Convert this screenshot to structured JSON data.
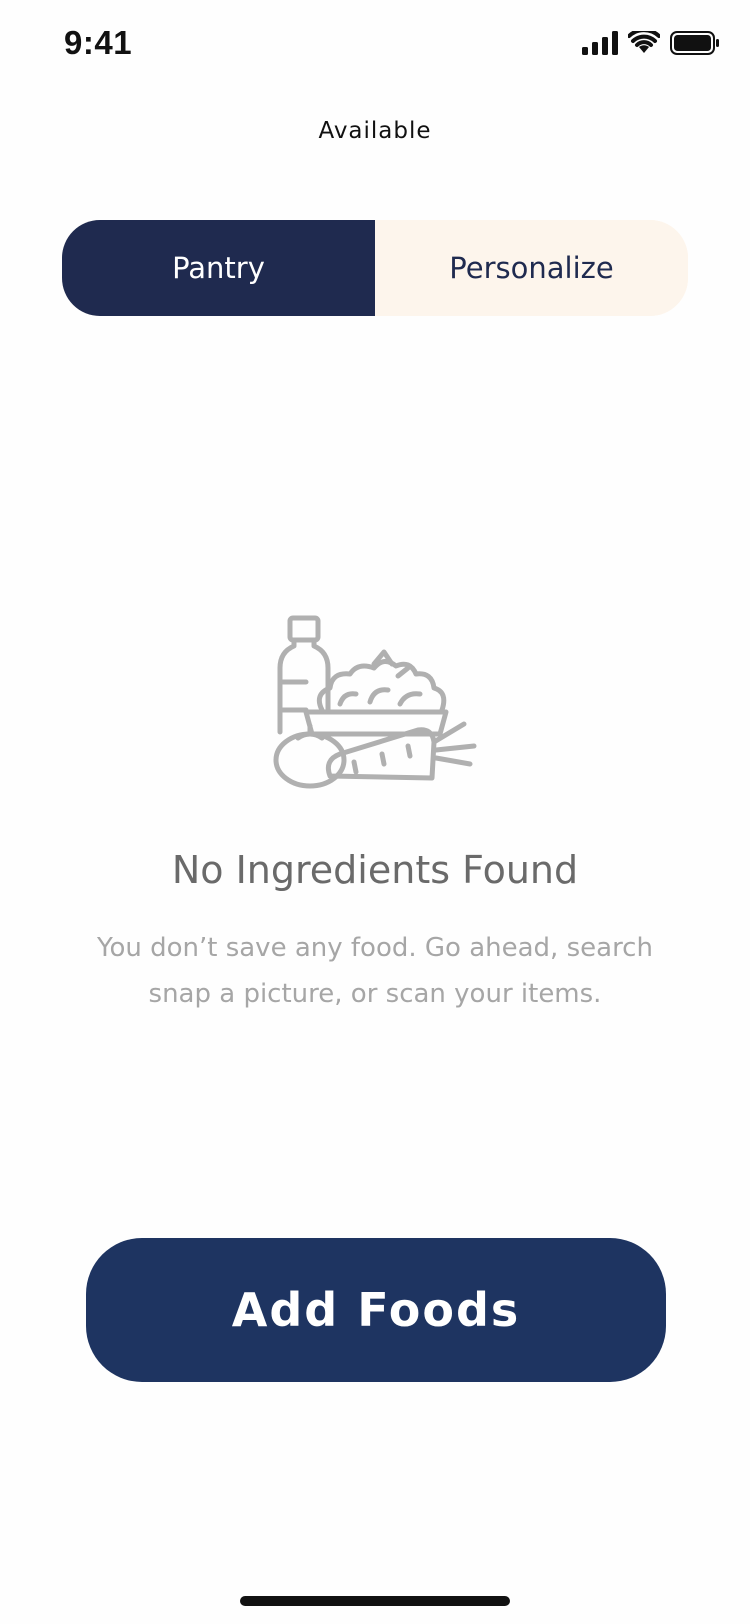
{
  "status_bar": {
    "time": "9:41",
    "icons": [
      "signal-icon",
      "wifi-icon",
      "battery-icon"
    ]
  },
  "header": {
    "title": "Available"
  },
  "segmented_control": {
    "tabs": [
      {
        "label": "Pantry",
        "active": true
      },
      {
        "label": "Personalize",
        "active": false
      }
    ]
  },
  "empty_state": {
    "icon": "groceries-icon",
    "title": "No Ingredients Found",
    "description_line1": "You don’t save any food. Go ahead, search",
    "description_line2": "snap a picture, or scan your items."
  },
  "actions": {
    "primary_label": "Add Foods"
  },
  "colors": {
    "primary": "#1f2a4f",
    "button": "#1e3461",
    "tab_inactive_bg": "#fdf5ec",
    "muted_text": "#a6a6a6",
    "icon_gray": "#b0b0b0"
  }
}
